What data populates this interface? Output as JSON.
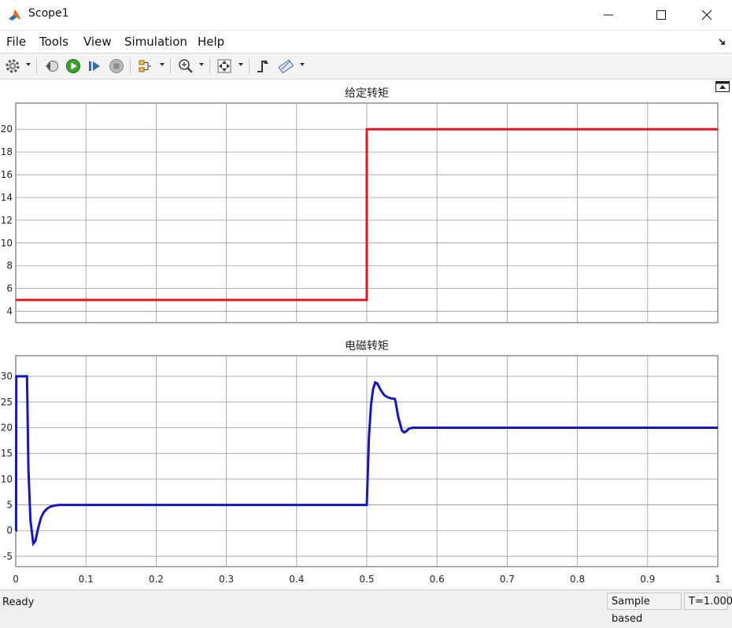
{
  "window": {
    "title": "Scope1"
  },
  "menu": [
    "File",
    "Tools",
    "View",
    "Simulation",
    "Help"
  ],
  "status": {
    "left": "Ready",
    "mode": "Sample based",
    "time": "T=1.000"
  },
  "colors": {
    "series1": "#e8141b",
    "series2": "#1414c8",
    "grid": "#9a9a9a"
  },
  "chart_data": [
    {
      "type": "line",
      "title": "给定转矩",
      "xlabel": "",
      "ylabel": "",
      "xlim": [
        0,
        1
      ],
      "ylim": [
        3,
        22.3
      ],
      "yticks": [
        4,
        6,
        8,
        10,
        12,
        14,
        16,
        18,
        20
      ],
      "xticks": [
        0,
        0.1,
        0.2,
        0.3,
        0.4,
        0.5,
        0.6,
        0.7,
        0.8,
        0.9,
        1
      ],
      "grid": true,
      "series": [
        {
          "x": [
            0,
            0.5,
            0.5,
            1
          ],
          "y": [
            5,
            5,
            20,
            20
          ]
        }
      ]
    },
    {
      "type": "line",
      "title": "电磁转矩",
      "xlabel": "",
      "ylabel": "",
      "xlim": [
        0,
        1
      ],
      "ylim": [
        -7,
        34
      ],
      "yticks": [
        -5,
        0,
        5,
        10,
        15,
        20,
        25,
        30
      ],
      "xticks": [
        0,
        0.1,
        0.2,
        0.3,
        0.4,
        0.5,
        0.6,
        0.7,
        0.8,
        0.9,
        1
      ],
      "xticklabels": [
        "0",
        "0.1",
        "0.2",
        "0.3",
        "0.4",
        "0.5",
        "0.6",
        "0.7",
        "0.8",
        "0.9",
        "1"
      ],
      "grid": true,
      "series": [
        {
          "x": [
            0,
            0.0005,
            0.0008,
            0.016,
            0.018,
            0.021,
            0.025,
            0.028,
            0.032,
            0.036,
            0.04,
            0.045,
            0.05,
            0.056,
            0.062,
            0.07,
            0.08,
            0.5,
            0.5,
            0.503,
            0.506,
            0.509,
            0.512,
            0.515,
            0.52,
            0.525,
            0.53,
            0.535,
            0.54,
            0.541,
            0.545,
            0.55,
            0.553,
            0.556,
            0.56,
            0.565,
            0.575,
            1
          ],
          "y": [
            0,
            0,
            30,
            30,
            12,
            2,
            -2.5,
            -2,
            0.5,
            2.5,
            3.6,
            4.3,
            4.7,
            4.9,
            5,
            5,
            5,
            5,
            5,
            18,
            24.5,
            27.5,
            28.8,
            28.6,
            27.3,
            26.3,
            25.9,
            25.7,
            25.6,
            25,
            22,
            19.5,
            19.1,
            19.3,
            19.8,
            20,
            20,
            20
          ]
        }
      ]
    }
  ]
}
